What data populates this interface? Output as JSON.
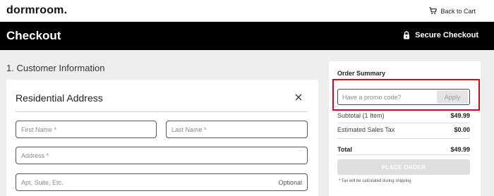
{
  "header": {
    "logo": "dormroom.",
    "back_to_cart": "Back to Cart",
    "page_title": "Checkout",
    "secure_checkout": "Secure Checkout",
    "cart_icon": "cart-icon",
    "lock_icon": "lock-icon"
  },
  "customer": {
    "section_title": "1. Customer Information",
    "card_title": "Residential Address",
    "close_icon": "close-icon",
    "fields": {
      "first_name": {
        "placeholder": "First Name *",
        "value": ""
      },
      "last_name": {
        "placeholder": "Last Name *",
        "value": ""
      },
      "address": {
        "placeholder": "Address *",
        "value": ""
      },
      "apt": {
        "placeholder": "Apt, Suite, Etc.",
        "value": "",
        "optional_label": "Optional"
      }
    }
  },
  "summary": {
    "title": "Order Summary",
    "promo": {
      "placeholder": "Have a promo code?",
      "value": "",
      "apply_label": "Apply"
    },
    "subtotal_label": "Subtotal (1 Item)",
    "subtotal_value": "$49.99",
    "tax_label": "Estimated Sales Tax",
    "tax_value": "$0.00",
    "total_label": "Total",
    "total_value": "$49.99",
    "place_order_label": "PLACE ORDER",
    "tax_note": "* Tax will be calculated during shipping"
  },
  "colors": {
    "header_background": "#000000",
    "highlight_border": "#e0001b",
    "page_background": "#eeeeee"
  }
}
